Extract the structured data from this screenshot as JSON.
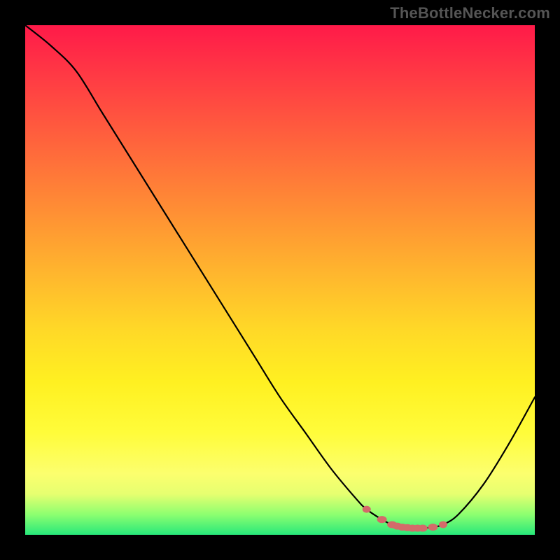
{
  "watermark": "TheBottleNecker.com",
  "colors": {
    "curve": "#000000",
    "marker": "#d46a6a",
    "gradient_top": "#ff1a49",
    "gradient_bottom": "#27e87a"
  },
  "chart_data": {
    "type": "line",
    "title": "",
    "xlabel": "",
    "ylabel": "",
    "xlim": [
      0,
      100
    ],
    "ylim": [
      0,
      100
    ],
    "x": [
      0,
      5,
      10,
      15,
      20,
      25,
      30,
      35,
      40,
      45,
      50,
      55,
      60,
      65,
      67,
      70,
      72,
      74,
      76,
      78,
      80,
      82,
      85,
      90,
      95,
      100
    ],
    "y": [
      100,
      96,
      91,
      83,
      75,
      67,
      59,
      51,
      43,
      35,
      27,
      20,
      13,
      7,
      5,
      3,
      2,
      1.5,
      1.3,
      1.3,
      1.5,
      2,
      4,
      10,
      18,
      27
    ],
    "optimal_range": {
      "x_start": 67,
      "x_end": 82,
      "markers_x": [
        67,
        70,
        72,
        73,
        74,
        75,
        76,
        77,
        78,
        80,
        82
      ],
      "markers_y": [
        5.0,
        3.0,
        2.0,
        1.7,
        1.5,
        1.4,
        1.3,
        1.3,
        1.3,
        1.5,
        2.0
      ]
    }
  }
}
